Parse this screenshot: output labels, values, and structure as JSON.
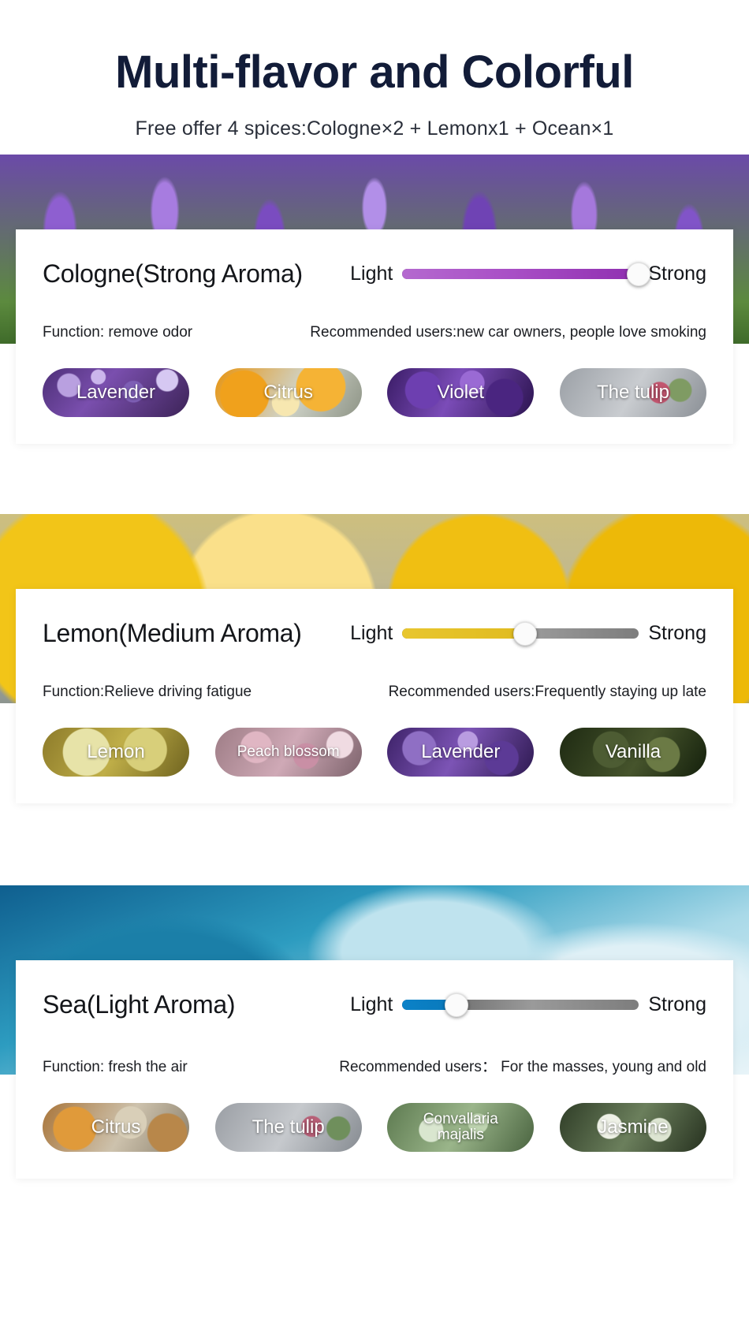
{
  "header": {
    "title": "Multi-flavor and Colorful",
    "subtitle": "Free offer 4 spices:Cologne×2 + Lemonx1 + Ocean×1"
  },
  "slider_labels": {
    "light": "Light",
    "strong": "Strong"
  },
  "cards": [
    {
      "id": "cologne",
      "title": "Cologne(Strong Aroma)",
      "slider": {
        "value": 100,
        "fill_color": "#b34ec4",
        "fill_gradient": "linear-gradient(90deg,#b469cf 0%,#a94fc6 45%,#8f2fb0 100%)"
      },
      "function_text": "Function: remove odor",
      "recommended_text": "Recommended users:new car owners, people love smoking",
      "pills": [
        {
          "label": "Lavender",
          "bg": "bg-lavender"
        },
        {
          "label": "Citrus",
          "bg": "bg-citrus"
        },
        {
          "label": "Violet",
          "bg": "bg-violet"
        },
        {
          "label": "The tulip",
          "bg": "bg-tulip"
        }
      ]
    },
    {
      "id": "lemon",
      "title": "Lemon(Medium Aroma)",
      "slider": {
        "value": 52,
        "fill_color": "#e5c228",
        "fill_gradient": "linear-gradient(90deg,#e8c62f 0%,#e0bb1f 100%)"
      },
      "function_text": "Function:Relieve driving fatigue",
      "recommended_text": "Recommended users:Frequently staying up late",
      "pills": [
        {
          "label": "Lemon",
          "bg": "bg-lemon"
        },
        {
          "label": "Peach blossom",
          "bg": "bg-peach"
        },
        {
          "label": "Lavender",
          "bg": "bg-lavender2"
        },
        {
          "label": "Vanilla",
          "bg": "bg-vanilla"
        }
      ]
    },
    {
      "id": "sea",
      "title": "Sea(Light Aroma)",
      "slider": {
        "value": 23,
        "fill_color": "#0a7fc4",
        "fill_gradient": "linear-gradient(90deg,#0b82c8 0%,#0a78ba 100%)"
      },
      "function_text": "Function: fresh the air",
      "recommended_text": "Recommended users： For the masses, young and old",
      "pills": [
        {
          "label": "Citrus",
          "bg": "bg-citrus2"
        },
        {
          "label": "The tulip",
          "bg": "bg-tulip2"
        },
        {
          "label": "Convallaria majalis",
          "bg": "bg-convallaria",
          "two_line": true
        },
        {
          "label": "Jasmine",
          "bg": "bg-jasmine"
        }
      ]
    }
  ]
}
